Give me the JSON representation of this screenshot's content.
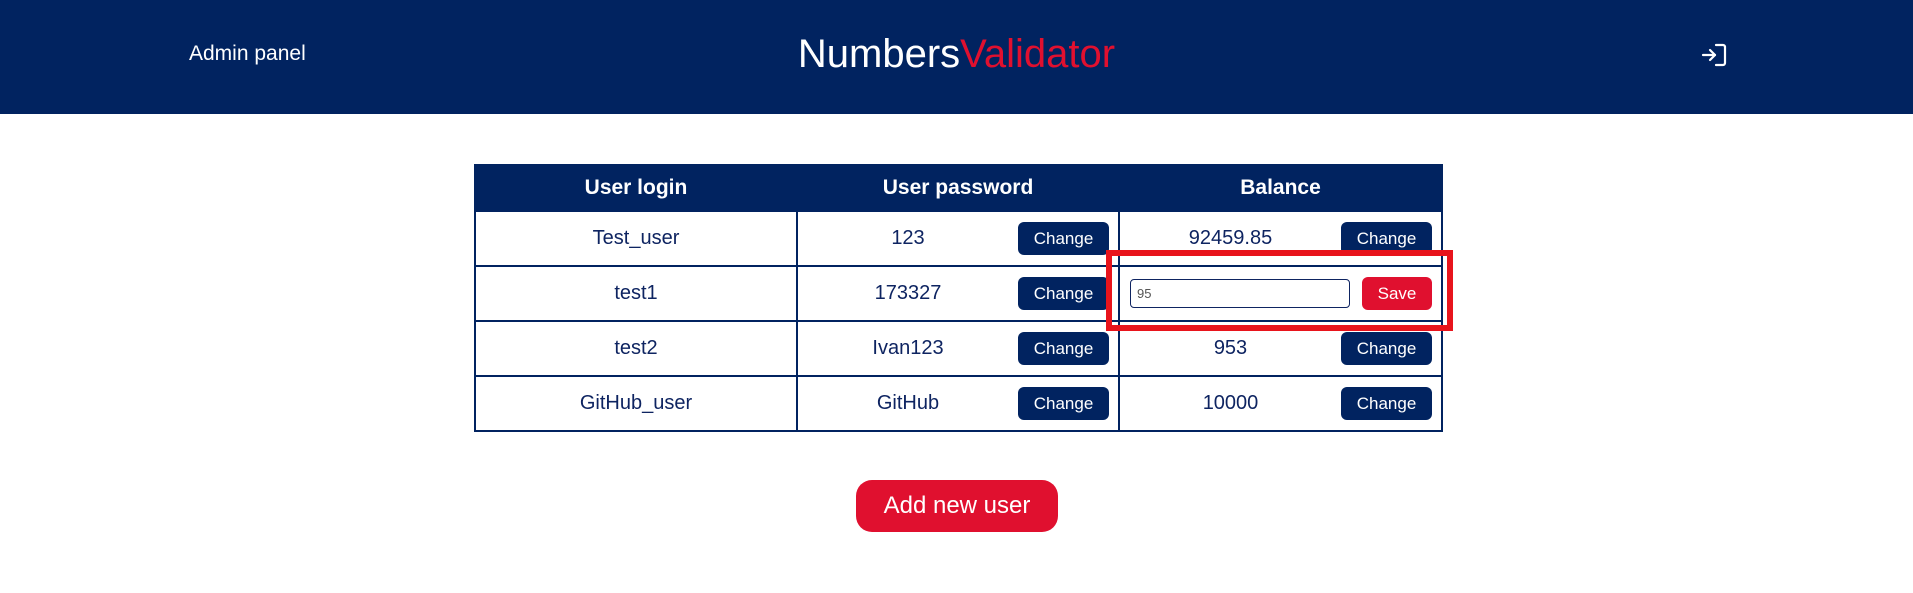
{
  "header": {
    "admin_link": "Admin panel",
    "brand_part1": "Numbers",
    "brand_part2": "Validator",
    "logout_icon": "login-icon"
  },
  "colors": {
    "primary": "#012360",
    "accent": "#e0102f",
    "highlight": "#e8141c"
  },
  "table": {
    "headers": [
      "User login",
      "User password",
      "Balance"
    ],
    "rows": [
      {
        "login": "Test_user",
        "password": "123",
        "password_button": "Change",
        "balance": "92459.85",
        "balance_button": "Change"
      },
      {
        "login": "test1",
        "password": "173327",
        "password_button": "Change",
        "balance_input_value": "95",
        "balance_button": "Save"
      },
      {
        "login": "test2",
        "password": "Ivan123",
        "password_button": "Change",
        "balance": "953",
        "balance_button": "Change"
      },
      {
        "login": "GitHub_user",
        "password": "GitHub",
        "password_button": "Change",
        "balance": "10000",
        "balance_button": "Change"
      }
    ]
  },
  "actions": {
    "add_user_label": "Add new user"
  }
}
